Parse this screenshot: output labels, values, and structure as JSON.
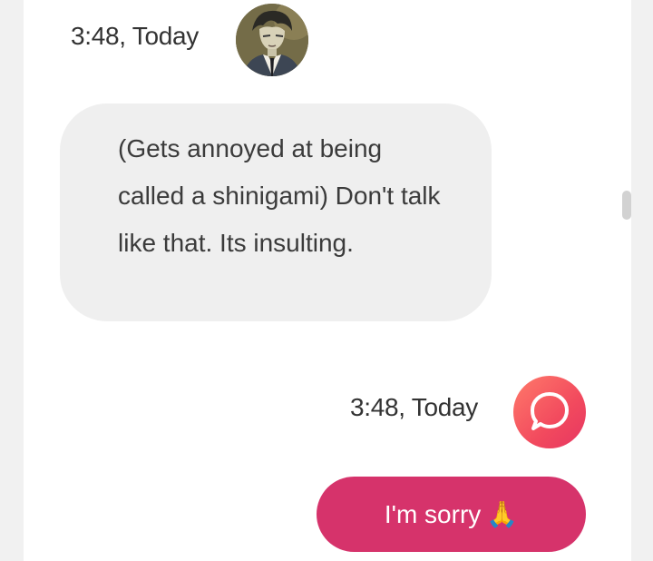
{
  "messages": {
    "bot": {
      "timestamp": "3:48, Today",
      "text": "(Gets annoyed at being called a shinigami) Don't talk like that. Its insulting.",
      "avatar_icon": "character-avatar"
    },
    "user": {
      "timestamp": "3:48, Today",
      "text": "I'm sorry",
      "emoji": "🙏",
      "avatar_icon": "chat-bubble-icon"
    }
  },
  "colors": {
    "user_bubble": "#d6336b",
    "bot_bubble": "#efefef",
    "app_icon_gradient_start": "#ff7a6a",
    "app_icon_gradient_end": "#e63561"
  }
}
